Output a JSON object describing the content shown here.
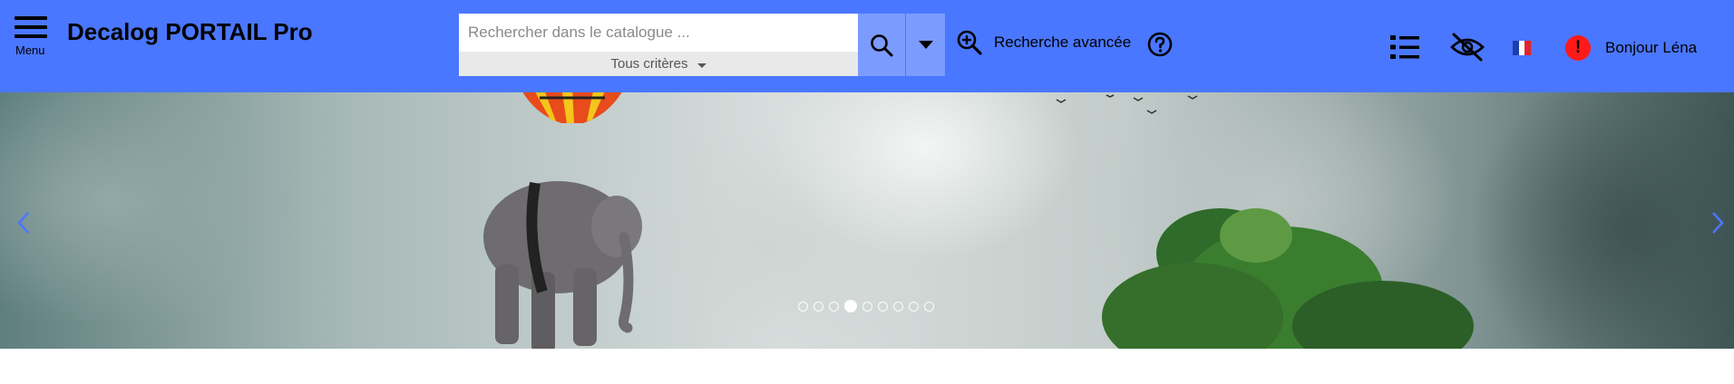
{
  "header": {
    "menu_label": "Menu",
    "site_title": "Decalog PORTAIL Pro",
    "background_color": "#4a77ff"
  },
  "search": {
    "placeholder": "Rechercher dans le catalogue ...",
    "value": "",
    "criteria_label": "Tous critères",
    "search_icon": "search-icon",
    "dropdown_icon": "caret-down-icon"
  },
  "advanced_search": {
    "label": "Recherche avancée",
    "icon": "zoom-in-icon"
  },
  "toolbar": {
    "help_icon": "help-circle-icon",
    "list_icon": "list-icon",
    "visibility_icon": "eye-slash-icon",
    "language_flag": "fr",
    "alert_symbol": "!",
    "alert_color": "#ff1a1a",
    "user_greeting": "Bonjour Léna"
  },
  "carousel": {
    "slide_count": 9,
    "active_index": 3,
    "prev_icon": "chevron-left-icon",
    "next_icon": "chevron-right-icon"
  }
}
